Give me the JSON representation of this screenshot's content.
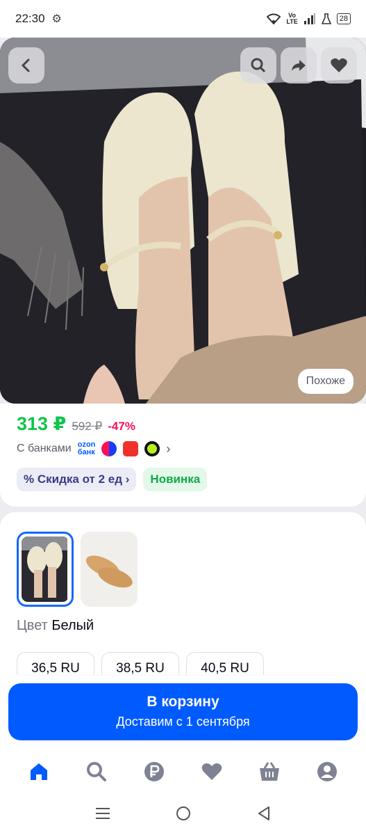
{
  "status_bar": {
    "time": "22:30",
    "network_top": "Vo",
    "network_bottom": "LTE",
    "battery": "28",
    "icons": [
      "gear-icon",
      "wifi-icon",
      "signal-icon",
      "flask-icon",
      "battery-icon"
    ]
  },
  "photo": {
    "similar_label": "Похоже",
    "buttons": [
      "back-icon",
      "search-icon",
      "share-icon",
      "heart-icon"
    ]
  },
  "price": {
    "current": "313 ₽",
    "old": "592 ₽",
    "discount": "-47%",
    "banks_label": "С банками",
    "ozon_top": "ozon",
    "ozon_bottom": "банк"
  },
  "chips": {
    "discount_label": "Скидка от 2 ед",
    "new_label": "Новинка"
  },
  "colors": {
    "brand": "#005bff",
    "price": "#10c44c",
    "discount": "#f91155",
    "selected_border": "#1566ff"
  },
  "variant": {
    "color_label": "Цвет",
    "color_value": "Белый",
    "sizes": [
      "36,5 RU",
      "38,5 RU",
      "40,5 RU"
    ]
  },
  "cart": {
    "title": "В корзину",
    "subtitle": "Доставим с 1 сентября"
  },
  "bottom_nav": [
    "home-icon",
    "search-icon",
    "ruble-icon",
    "heart-icon",
    "basket-icon",
    "profile-icon"
  ]
}
